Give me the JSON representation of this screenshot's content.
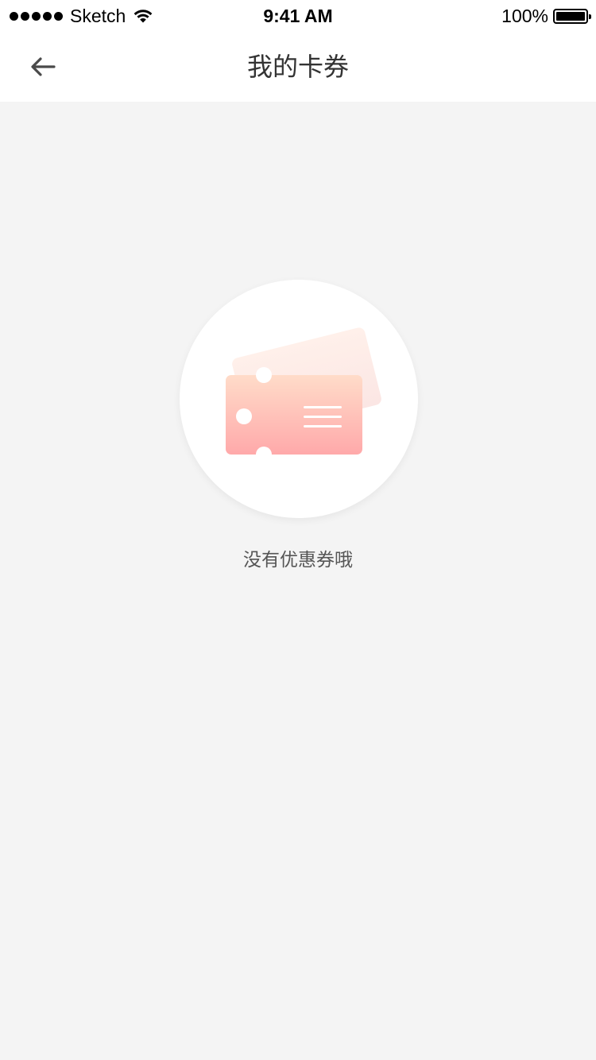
{
  "status_bar": {
    "carrier": "Sketch",
    "time": "9:41 AM",
    "battery_percent": "100%",
    "signal_icon": "signal-dots-icon",
    "wifi_icon": "wifi-icon",
    "battery_icon": "battery-full-icon"
  },
  "nav": {
    "back_icon": "arrow-left-icon",
    "title": "我的卡券"
  },
  "empty_state": {
    "illustration_icon": "coupon-ticket-icon",
    "message": "没有优惠券哦"
  },
  "colors": {
    "page_background": "#f4f4f4",
    "header_background": "#ffffff",
    "coupon_gradient_top": "#ffdcc9",
    "coupon_gradient_bottom": "#ffa9aa"
  }
}
